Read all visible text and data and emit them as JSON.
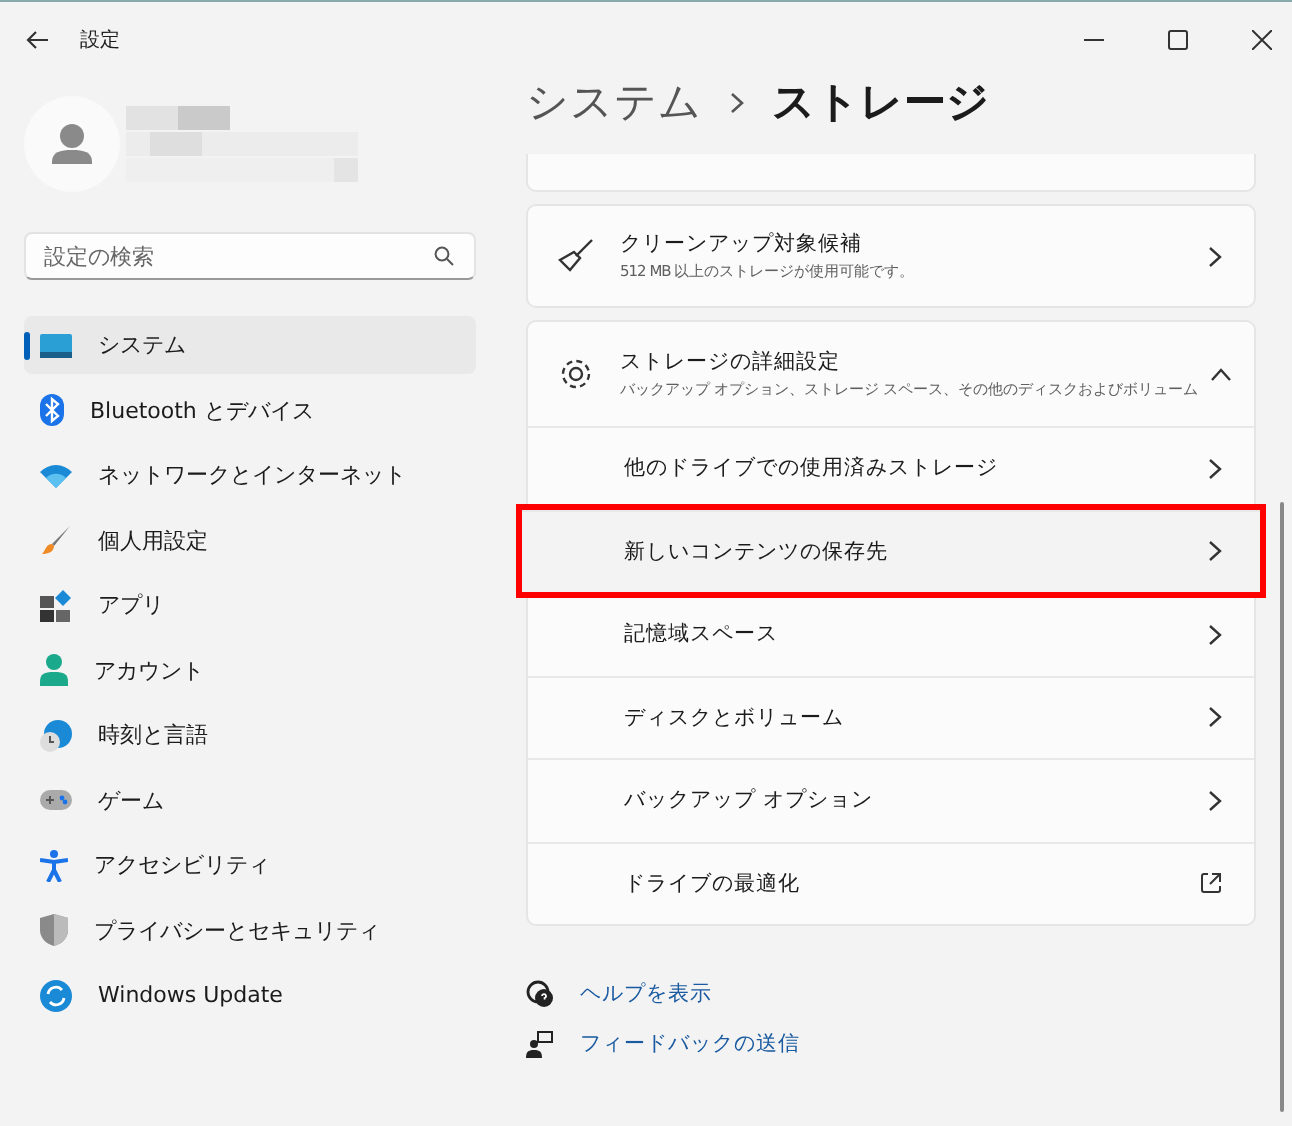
{
  "window": {
    "title": "設定"
  },
  "sidebar": {
    "search": {
      "placeholder": "設定の検索"
    },
    "items": [
      {
        "label": "システム",
        "selected": true
      },
      {
        "label": "Bluetooth とデバイス",
        "selected": false
      },
      {
        "label": "ネットワークとインターネット",
        "selected": false
      },
      {
        "label": "個人用設定",
        "selected": false
      },
      {
        "label": "アプリ",
        "selected": false
      },
      {
        "label": "アカウント",
        "selected": false
      },
      {
        "label": "時刻と言語",
        "selected": false
      },
      {
        "label": "ゲーム",
        "selected": false
      },
      {
        "label": "アクセシビリティ",
        "selected": false
      },
      {
        "label": "プライバシーとセキュリティ",
        "selected": false
      },
      {
        "label": "Windows Update",
        "selected": false
      }
    ]
  },
  "breadcrumb": [
    {
      "label": "システム",
      "current": false
    },
    {
      "label": "ストレージ",
      "current": true
    }
  ],
  "cleanup_card": {
    "title": "クリーンアップ対象候補",
    "subtitle": "512 MB 以上のストレージが使用可能です。"
  },
  "advanced_card": {
    "title": "ストレージの詳細設定",
    "subtitle": "バックアップ オプション、ストレージ スペース、その他のディスクおよびボリューム",
    "expanded": true,
    "rows": [
      {
        "label": "他のドライブでの使用済みストレージ",
        "kind": "chevron",
        "highlighted": false
      },
      {
        "label": "新しいコンテンツの保存先",
        "kind": "chevron",
        "highlighted": true
      },
      {
        "label": "記憶域スペース",
        "kind": "chevron",
        "highlighted": false
      },
      {
        "label": "ディスクとボリューム",
        "kind": "chevron",
        "highlighted": false
      },
      {
        "label": "バックアップ オプション",
        "kind": "chevron",
        "highlighted": false
      },
      {
        "label": "ドライブの最適化",
        "kind": "external",
        "highlighted": false
      }
    ]
  },
  "help_links": [
    {
      "label": "ヘルプを表示"
    },
    {
      "label": "フィードバックの送信"
    }
  ]
}
